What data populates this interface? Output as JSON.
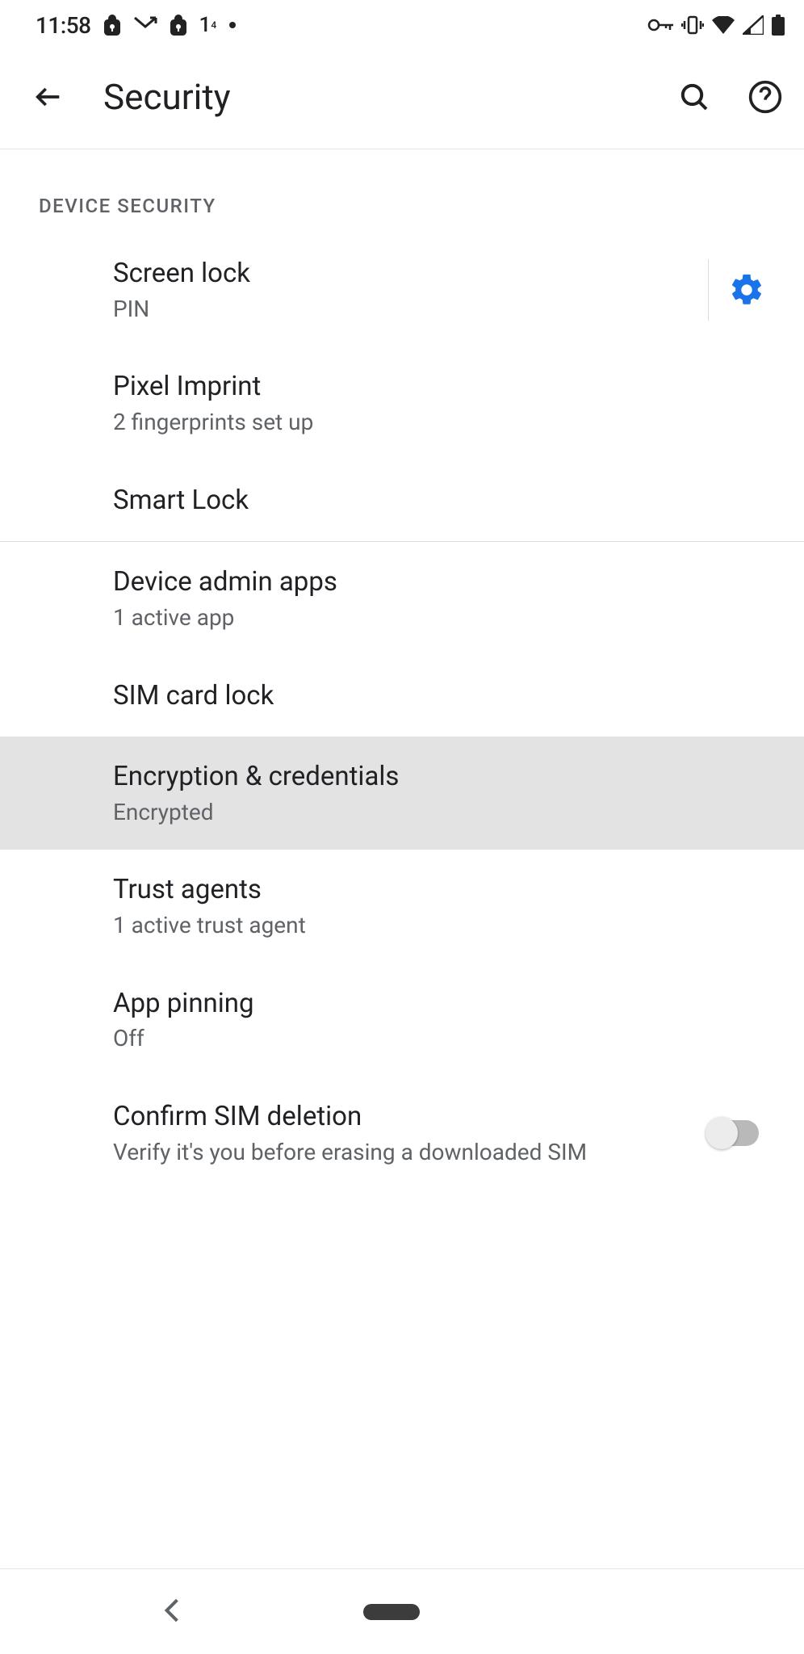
{
  "statusbar": {
    "time": "11:58"
  },
  "appbar": {
    "title": "Security"
  },
  "sectionHeader": "DEVICE SECURITY",
  "items": {
    "screenlock": {
      "title": "Screen lock",
      "subtitle": "PIN"
    },
    "pixelimprint": {
      "title": "Pixel Imprint",
      "subtitle": "2 fingerprints set up"
    },
    "smartlock": {
      "title": "Smart Lock"
    },
    "deviceadmin": {
      "title": "Device admin apps",
      "subtitle": "1 active app"
    },
    "simlock": {
      "title": "SIM card lock"
    },
    "encryption": {
      "title": "Encryption & credentials",
      "subtitle": "Encrypted"
    },
    "trustagents": {
      "title": "Trust agents",
      "subtitle": "1 active trust agent"
    },
    "apppinning": {
      "title": "App pinning",
      "subtitle": "Off"
    },
    "confirmsim": {
      "title": "Confirm SIM deletion",
      "subtitle": "Verify it's you before erasing a downloaded SIM"
    }
  }
}
